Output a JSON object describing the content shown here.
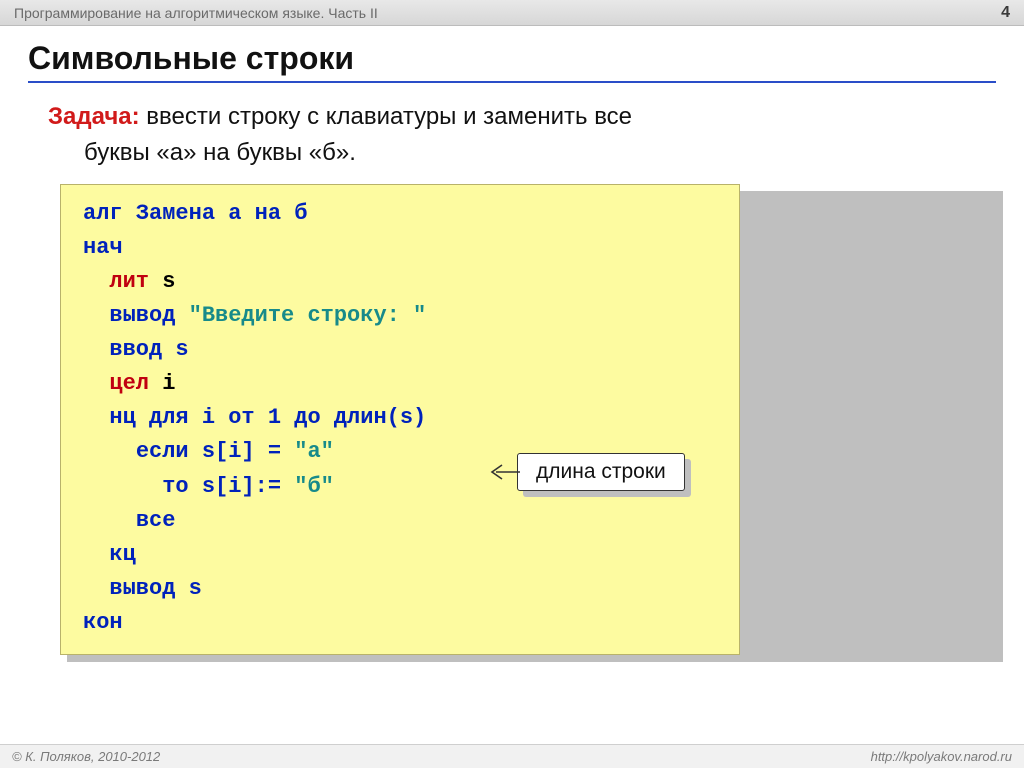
{
  "header": {
    "breadcrumb": "Программирование на алгоритмическом языке. Часть II",
    "page_number": "4"
  },
  "title": "Символьные строки",
  "task": {
    "label": "Задача:",
    "line1_rest": " ввести строку с клавиатуры и заменить все",
    "line2": "буквы «а» на буквы «б»."
  },
  "code": {
    "l1_kw": "алг ",
    "l1_name": "Замена а на б",
    "l2": "нач",
    "l3_kw": "лит",
    "l3_var": " s",
    "l4_kw": "вывод ",
    "l4_str": "\"Введите строку: \"",
    "l5": "ввод s",
    "l6_kw": "цел",
    "l6_var": " i",
    "l7_a": "нц для i от 1 до ",
    "l7_fn": "длин",
    "l7_b": "(s)",
    "l8_a": "если s[i] = ",
    "l8_str": "\"а\"",
    "l9_a": "то s[i]:= ",
    "l9_str": "\"б\"",
    "l10": "все",
    "l11": "кц",
    "l12": "вывод s",
    "l13": "кон"
  },
  "callout": "длина строки",
  "footer": {
    "copyright": "© К. Поляков, 2010-2012",
    "url": "http://kpolyakov.narod.ru"
  }
}
